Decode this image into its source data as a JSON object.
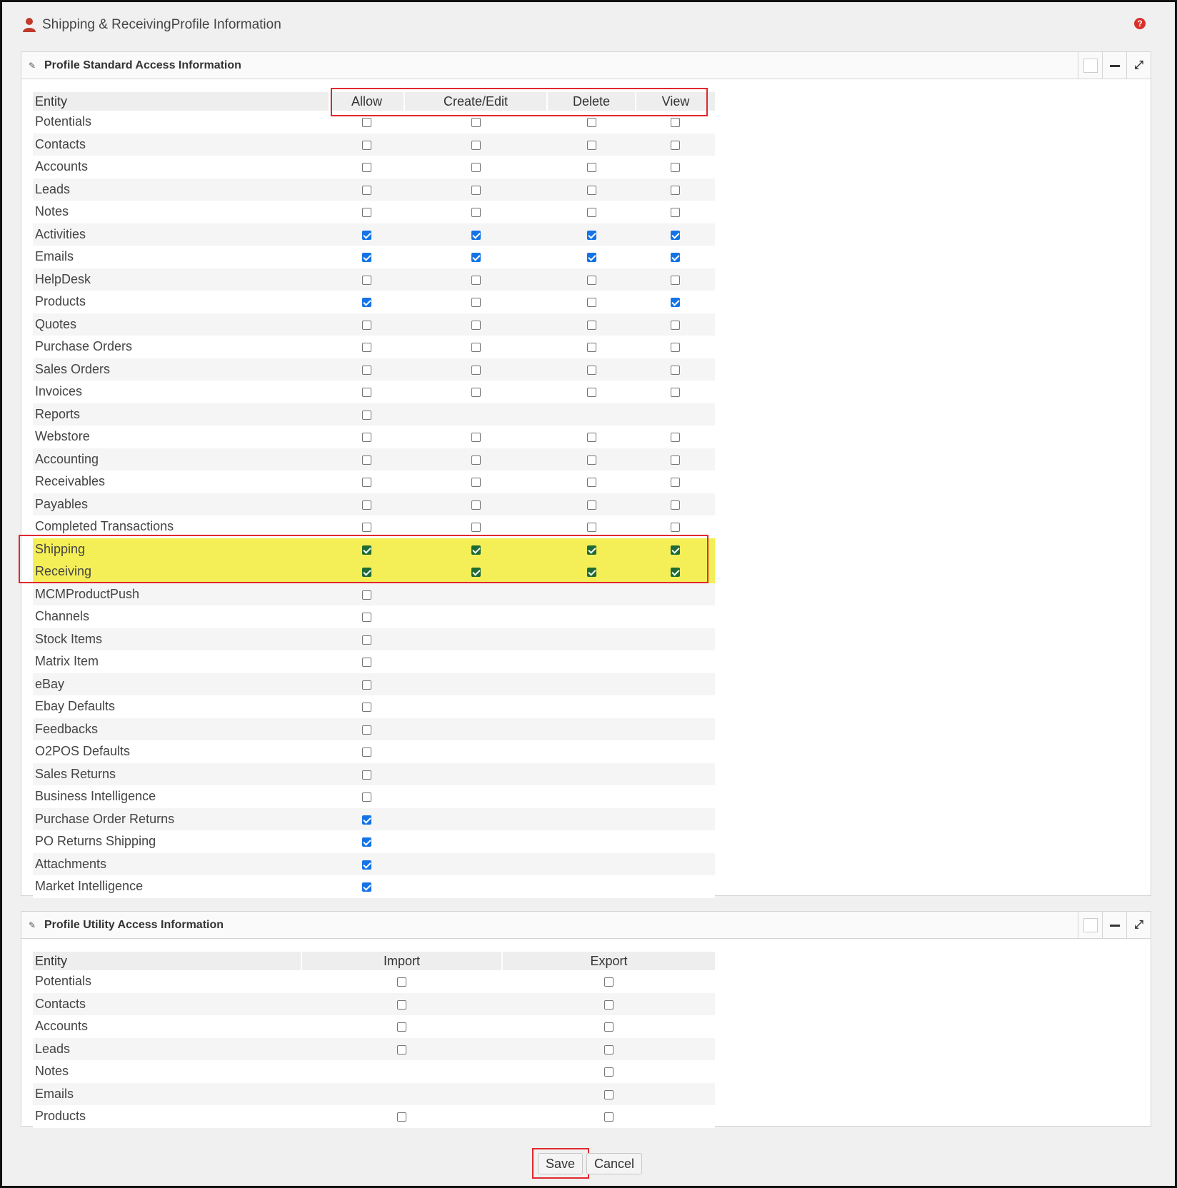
{
  "header": {
    "title": "Shipping & ReceivingProfile Information"
  },
  "standard": {
    "title": "Profile Standard Access Information",
    "columns": [
      "Entity",
      "Allow",
      "Create/Edit",
      "Delete",
      "View"
    ],
    "rows": [
      {
        "entity": "Potentials",
        "cells": [
          0,
          0,
          0,
          0
        ]
      },
      {
        "entity": "Contacts",
        "cells": [
          0,
          0,
          0,
          0
        ]
      },
      {
        "entity": "Accounts",
        "cells": [
          0,
          0,
          0,
          0
        ]
      },
      {
        "entity": "Leads",
        "cells": [
          0,
          0,
          0,
          0
        ]
      },
      {
        "entity": "Notes",
        "cells": [
          0,
          0,
          0,
          0
        ]
      },
      {
        "entity": "Activities",
        "cells": [
          1,
          1,
          1,
          1
        ]
      },
      {
        "entity": "Emails",
        "cells": [
          1,
          1,
          1,
          1
        ]
      },
      {
        "entity": "HelpDesk",
        "cells": [
          0,
          0,
          0,
          0
        ]
      },
      {
        "entity": "Products",
        "cells": [
          1,
          0,
          0,
          1
        ]
      },
      {
        "entity": "Quotes",
        "cells": [
          0,
          0,
          0,
          0
        ]
      },
      {
        "entity": "Purchase Orders",
        "cells": [
          0,
          0,
          0,
          0
        ]
      },
      {
        "entity": "Sales Orders",
        "cells": [
          0,
          0,
          0,
          0
        ]
      },
      {
        "entity": "Invoices",
        "cells": [
          0,
          0,
          0,
          0
        ]
      },
      {
        "entity": "Reports",
        "cells": [
          0,
          null,
          null,
          null
        ]
      },
      {
        "entity": "Webstore",
        "cells": [
          0,
          0,
          0,
          0
        ]
      },
      {
        "entity": "Accounting",
        "cells": [
          0,
          0,
          0,
          0
        ]
      },
      {
        "entity": "Receivables",
        "cells": [
          0,
          0,
          0,
          0
        ]
      },
      {
        "entity": "Payables",
        "cells": [
          0,
          0,
          0,
          0
        ]
      },
      {
        "entity": "Completed Transactions",
        "cells": [
          0,
          0,
          0,
          0
        ]
      },
      {
        "entity": "Shipping",
        "cells": [
          1,
          1,
          1,
          1
        ],
        "highlight": true
      },
      {
        "entity": "Receiving",
        "cells": [
          1,
          1,
          1,
          1
        ],
        "highlight": true
      },
      {
        "entity": "MCMProductPush",
        "cells": [
          0,
          null,
          null,
          null
        ]
      },
      {
        "entity": "Channels",
        "cells": [
          0,
          null,
          null,
          null
        ]
      },
      {
        "entity": "Stock Items",
        "cells": [
          0,
          null,
          null,
          null
        ]
      },
      {
        "entity": "Matrix Item",
        "cells": [
          0,
          null,
          null,
          null
        ]
      },
      {
        "entity": "eBay",
        "cells": [
          0,
          null,
          null,
          null
        ]
      },
      {
        "entity": "Ebay Defaults",
        "cells": [
          0,
          null,
          null,
          null
        ]
      },
      {
        "entity": "Feedbacks",
        "cells": [
          0,
          null,
          null,
          null
        ]
      },
      {
        "entity": "O2POS Defaults",
        "cells": [
          0,
          null,
          null,
          null
        ]
      },
      {
        "entity": "Sales Returns",
        "cells": [
          0,
          null,
          null,
          null
        ]
      },
      {
        "entity": "Business Intelligence",
        "cells": [
          0,
          null,
          null,
          null
        ]
      },
      {
        "entity": "Purchase Order Returns",
        "cells": [
          1,
          null,
          null,
          null
        ]
      },
      {
        "entity": "PO Returns Shipping",
        "cells": [
          1,
          null,
          null,
          null
        ]
      },
      {
        "entity": "Attachments",
        "cells": [
          1,
          null,
          null,
          null
        ]
      },
      {
        "entity": "Market Intelligence",
        "cells": [
          1,
          null,
          null,
          null
        ]
      }
    ]
  },
  "utility": {
    "title": "Profile Utility Access Information",
    "columns": [
      "Entity",
      "Import",
      "Export"
    ],
    "rows": [
      {
        "entity": "Potentials",
        "cells": [
          0,
          0
        ]
      },
      {
        "entity": "Contacts",
        "cells": [
          0,
          0
        ]
      },
      {
        "entity": "Accounts",
        "cells": [
          0,
          0
        ]
      },
      {
        "entity": "Leads",
        "cells": [
          0,
          0
        ]
      },
      {
        "entity": "Notes",
        "cells": [
          null,
          0
        ]
      },
      {
        "entity": "Emails",
        "cells": [
          null,
          0
        ]
      },
      {
        "entity": "Products",
        "cells": [
          0,
          0
        ]
      }
    ]
  },
  "actions": {
    "save": "Save",
    "cancel": "Cancel"
  },
  "colors": {
    "highlight": "#f5ef57",
    "annotation": "#e0282e",
    "checked": "#1473e6",
    "checked_highlight": "#1e6b35"
  }
}
